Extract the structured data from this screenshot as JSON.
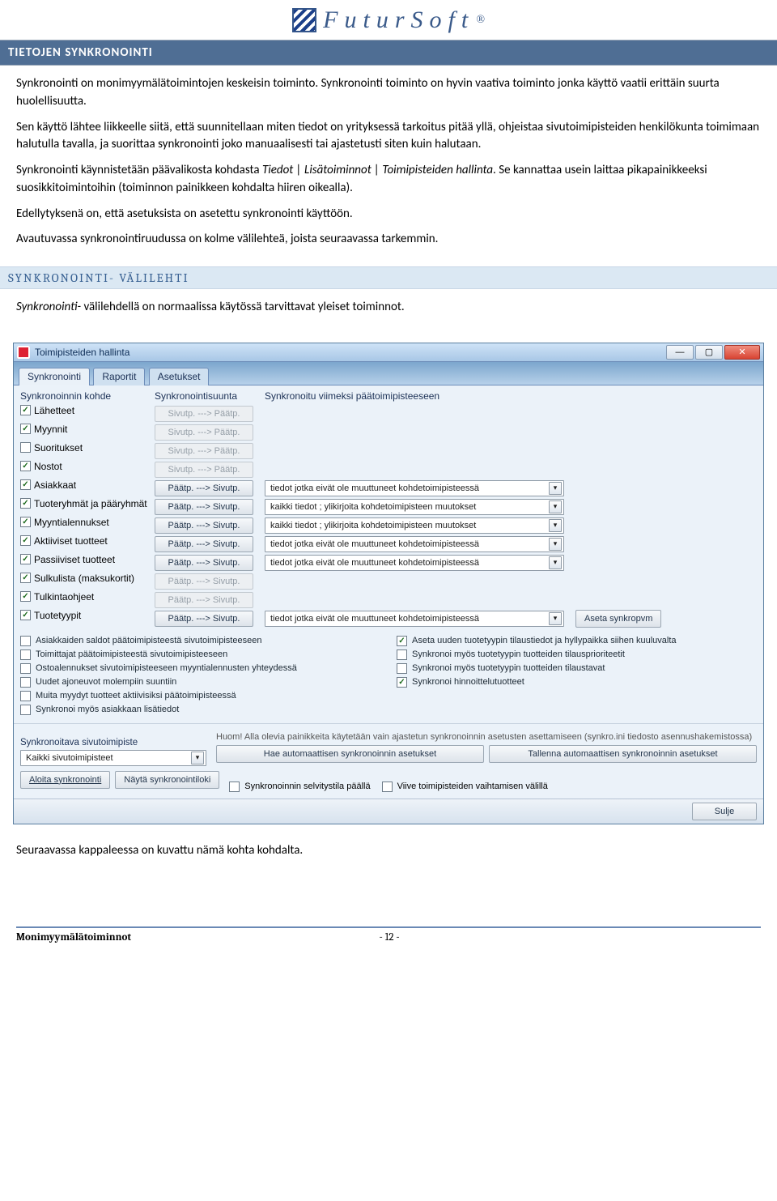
{
  "logo": {
    "brand": "FuturSoft",
    "reg": "®"
  },
  "heading1": "TIETOJEN SYNKRONOINTI",
  "para1": "Synkronointi on monimyymälätoimintojen keskeisin toiminto. Synkronointi toiminto on hyvin vaativa toiminto jonka käyttö vaatii erittäin suurta huolellisuutta.",
  "para2": "Sen käyttö lähtee liikkeelle siitä, että suunnitellaan miten tiedot on yrityksessä tarkoitus pitää yllä, ohjeistaa sivutoimipisteiden henkilökunta toimimaan halutulla tavalla, ja suorittaa synkronointi joko manuaalisesti tai ajastetusti siten kuin halutaan.",
  "para3a": "Synkronointi käynnistetään päävalikosta kohdasta ",
  "para3b": "Tiedot | Lisätoiminnot | Toimipisteiden hallinta",
  "para3c": ". Se kannattaa usein laittaa pikapainikkeeksi suosikkitoimintoihin (toiminnon painikkeen kohdalta hiiren oikealla).",
  "para4": "Edellytyksenä on, että asetuksista on asetettu synkronointi käyttöön.",
  "para5": "Avautuvassa synkronointiruudussa on kolme välilehteä, joista seuraavassa tarkemmin.",
  "heading2": "SYNKRONOINTI- VÄLILEHTI",
  "para6a": "Synkronointi-",
  "para6b": " välilehdellä on normaalissa käytössä tarvittavat yleiset toiminnot.",
  "para7": "Seuraavassa kappaleessa on kuvattu nämä kohta kohdalta.",
  "win": {
    "title": "Toimipisteiden hallinta",
    "tabs": [
      "Synkronointi",
      "Raportit",
      "Asetukset"
    ],
    "colhdr": {
      "c1": "Synkronoinnin kohde",
      "c2": "Synkronointisuunta",
      "c3": "Synkronoitu viimeksi päätoimipisteeseen"
    },
    "dir_out": "Sivutp. ---> Päätp.",
    "dir_in": "Päätp. ---> Sivutp.",
    "rows": [
      {
        "label": "Lähetteet",
        "checked": true,
        "dir": "out",
        "disabled": true,
        "sel": ""
      },
      {
        "label": "Myynnit",
        "checked": true,
        "dir": "out",
        "disabled": true,
        "sel": ""
      },
      {
        "label": "Suoritukset",
        "checked": false,
        "dir": "out",
        "disabled": true,
        "sel": ""
      },
      {
        "label": "Nostot",
        "checked": true,
        "dir": "out",
        "disabled": true,
        "sel": ""
      },
      {
        "label": "Asiakkaat",
        "checked": true,
        "dir": "in",
        "disabled": false,
        "sel": "tiedot jotka eivät ole muuttuneet kohdetoimipisteessä"
      },
      {
        "label": "Tuoteryhmät ja pääryhmät",
        "checked": true,
        "dir": "in",
        "disabled": false,
        "sel": "kaikki tiedot ; ylikirjoita kohdetoimipisteen muutokset"
      },
      {
        "label": "Myyntialennukset",
        "checked": true,
        "dir": "in",
        "disabled": false,
        "sel": "kaikki tiedot ; ylikirjoita kohdetoimipisteen muutokset"
      },
      {
        "label": "Aktiiviset tuotteet",
        "checked": true,
        "dir": "in",
        "disabled": false,
        "sel": "tiedot jotka eivät ole muuttuneet kohdetoimipisteessä"
      },
      {
        "label": "Passiiviset tuotteet",
        "checked": true,
        "dir": "in",
        "disabled": false,
        "sel": "tiedot jotka eivät ole muuttuneet kohdetoimipisteessä"
      },
      {
        "label": "Sulkulista (maksukortit)",
        "checked": true,
        "dir": "in",
        "disabled": true,
        "sel": ""
      },
      {
        "label": "Tulkintaohjeet",
        "checked": true,
        "dir": "in",
        "disabled": true,
        "sel": ""
      },
      {
        "label": "Tuotetyypit",
        "checked": true,
        "dir": "in",
        "disabled": false,
        "sel": "tiedot jotka eivät ole muuttuneet kohdetoimipisteessä",
        "extra": "Aseta synkropvm"
      }
    ],
    "lower_left": [
      {
        "checked": false,
        "label": "Asiakkaiden saldot päätoimipisteestä sivutoimipisteeseen"
      },
      {
        "checked": false,
        "label": "Toimittajat päätoimipisteestä sivutoimipisteeseen"
      },
      {
        "checked": false,
        "label": "Ostoalennukset sivutoimipisteeseen myyntialennusten yhteydessä"
      },
      {
        "checked": false,
        "label": "Uudet ajoneuvot molempiin suuntiin"
      },
      {
        "checked": false,
        "label": "Muita myydyt tuotteet aktiivisiksi päätoimipisteessä"
      },
      {
        "checked": false,
        "label": "Synkronoi myös asiakkaan lisätiedot"
      }
    ],
    "lower_right": [
      {
        "checked": true,
        "label": "Aseta uuden tuotetyypin tilaustiedot ja hyllypaikka siihen kuuluvalta"
      },
      {
        "checked": false,
        "label": "Synkronoi myös tuotetyypin tuotteiden tilausprioriteetit"
      },
      {
        "checked": false,
        "label": "Synkronoi myös tuotetyypin tuotteiden tilaustavat"
      },
      {
        "checked": true,
        "label": "Synkronoi hinnoittelutuotteet"
      }
    ],
    "bottom": {
      "lbl_left": "Synkronoitava sivutoimipiste",
      "sel_left": "Kaikki sivutoimipisteet",
      "btn_left1": "Aloita synkronointi",
      "btn_left2": "Näytä synkronointiloki",
      "hint": "Huom! Alla olevia painikkeita käytetään vain ajastetun synkronoinnin asetusten asettamiseen (synkro.ini tiedosto asennushakemistossa)",
      "btn_r1": "Hae automaattisen synkronoinnin asetukset",
      "btn_r2": "Tallenna automaattisen synkronoinnin asetukset",
      "ck_r1": "Synkronoinnin selvitystila päällä",
      "ck_r2": "Viive toimipisteiden vaihtamisen välillä"
    },
    "close": "Sulje"
  },
  "footer": {
    "left": "Monimyymälätoiminnot",
    "page": "- 12 -"
  }
}
